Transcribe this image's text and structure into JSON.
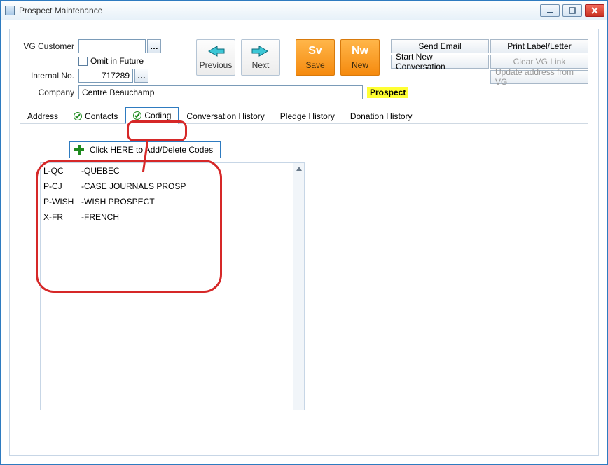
{
  "window": {
    "title": "Prospect Maintenance"
  },
  "labels": {
    "vg_customer": "VG Customer",
    "omit_in_future": "Omit in Future",
    "internal_no": "Internal No.",
    "company": "Company"
  },
  "fields": {
    "vg_customer_value": "",
    "internal_no_value": "717289",
    "company_value": "Centre Beauchamp"
  },
  "badge": {
    "prospect": "Prospect"
  },
  "nav": {
    "previous": "Previous",
    "next": "Next",
    "save": "Save",
    "save_glyph": "Sv",
    "new": "New",
    "new_glyph": "Nw"
  },
  "actions": {
    "send_email": "Send Email",
    "print_label_letter": "Print Label/Letter",
    "start_new_conversation": "Start New Conversation",
    "clear_vg_link": "Clear VG Link",
    "update_address_from_vg": "Update address from VG"
  },
  "tabs": {
    "address": "Address",
    "contacts": "Contacts",
    "coding": "Coding",
    "conversation_history": "Conversation History",
    "pledge_history": "Pledge History",
    "donation_history": "Donation History"
  },
  "coding": {
    "add_delete_label": "Click HERE to Add/Delete Codes",
    "codes": [
      {
        "code": "L-QC",
        "desc": "-QUEBEC"
      },
      {
        "code": "P-CJ",
        "desc": "-CASE JOURNALS PROSP"
      },
      {
        "code": "P-WISH",
        "desc": "-WISH PROSPECT"
      },
      {
        "code": "X-FR",
        "desc": "-FRENCH"
      }
    ]
  }
}
